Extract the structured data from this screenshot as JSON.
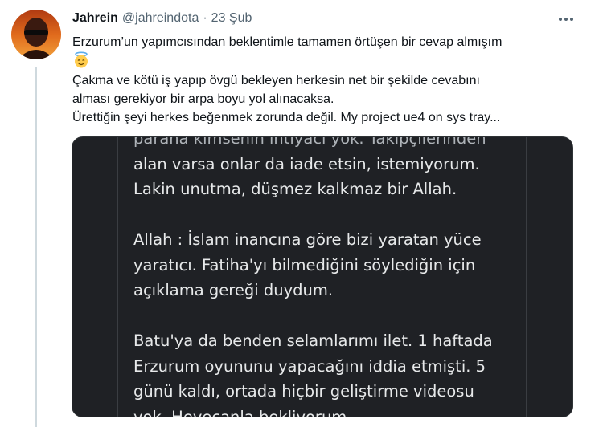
{
  "tweet": {
    "author_name": "Jahrein",
    "handle": "@jahreindota",
    "separator": "·",
    "date": "23 Şub",
    "line1": "Erzurum’un yapımcısından beklentimle tamamen örtüşen bir cevap almışım",
    "emoji_icon": "smiling-face-with-halo-icon",
    "line2": "Çakma ve kötü iş yapıp övgü bekleyen herkesin net bir şekilde cevabını",
    "line3": "alması gerekiyor bir arpa boyu yol alınacaksa.",
    "line4": "Ürettiğin şeyi herkes beğenmek zorunda değil. My project ue4 on sys tray..."
  },
  "media": {
    "lines": [
      "parana kimsenin ihtiyacı yok. Takipçilerinden",
      "alan varsa onlar da iade etsin, istemiyorum.",
      "Lakin unutma, düşmez kalkmaz bir Allah.",
      "",
      "Allah : İslam inancına göre bizi yaratan yüce",
      "yaratıcı. Fatiha'yı bilmediğini söylediğin için",
      "açıklama gereği duydum.",
      "",
      "Batu'ya da benden selamlarımı ilet. 1 haftada",
      "Erzurum oyununu yapacağını iddia etmişti. 5",
      "günü kaldı, ortada hiçbir geliştirme videosu",
      "yok. Heyecanla bekliyorum..."
    ]
  },
  "colors": {
    "text": "#0f1419",
    "secondary": "#536471",
    "media_bg": "#1f2125",
    "media_text": "#e7e9ea"
  }
}
